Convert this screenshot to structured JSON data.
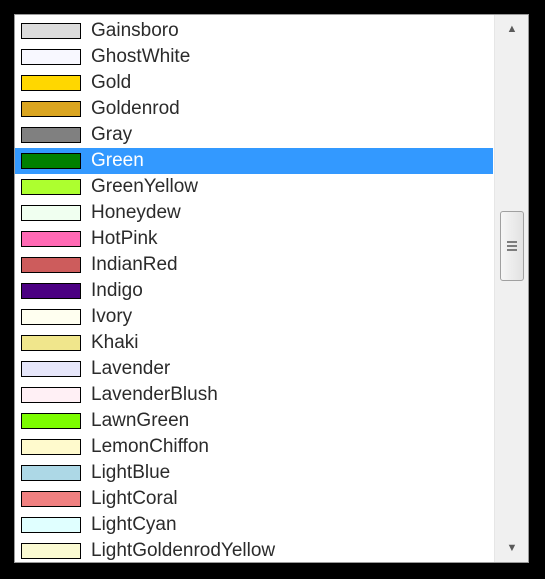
{
  "colors": [
    {
      "name": "Gainsboro",
      "color": "#dcdcdc"
    },
    {
      "name": "GhostWhite",
      "color": "#f8f8ff"
    },
    {
      "name": "Gold",
      "color": "#ffd700"
    },
    {
      "name": "Goldenrod",
      "color": "#daa520"
    },
    {
      "name": "Gray",
      "color": "#808080"
    },
    {
      "name": "Green",
      "color": "#008000"
    },
    {
      "name": "GreenYellow",
      "color": "#adff2f"
    },
    {
      "name": "Honeydew",
      "color": "#f0fff0"
    },
    {
      "name": "HotPink",
      "color": "#ff69b4"
    },
    {
      "name": "IndianRed",
      "color": "#cd5c5c"
    },
    {
      "name": "Indigo",
      "color": "#4b0082"
    },
    {
      "name": "Ivory",
      "color": "#fffff0"
    },
    {
      "name": "Khaki",
      "color": "#f0e68c"
    },
    {
      "name": "Lavender",
      "color": "#e6e6fa"
    },
    {
      "name": "LavenderBlush",
      "color": "#fff0f5"
    },
    {
      "name": "LawnGreen",
      "color": "#7cfc00"
    },
    {
      "name": "LemonChiffon",
      "color": "#fffacd"
    },
    {
      "name": "LightBlue",
      "color": "#add8e6"
    },
    {
      "name": "LightCoral",
      "color": "#f08080"
    },
    {
      "name": "LightCyan",
      "color": "#e0ffff"
    },
    {
      "name": "LightGoldenrodYellow",
      "color": "#fafad2"
    }
  ],
  "selected": "Green",
  "selection_color": "#3399ff",
  "scroll_up_icon": "▲",
  "scroll_down_icon": "▼"
}
